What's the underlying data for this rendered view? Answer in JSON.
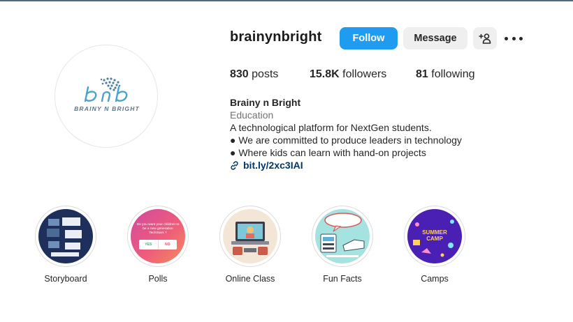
{
  "profile": {
    "username": "brainynbright",
    "avatar_logo_text": "BRAINY N BRIGHT",
    "buttons": {
      "follow": "Follow",
      "message": "Message",
      "add_user_icon": "person-plus-icon",
      "more_icon": "more-horizontal-icon"
    },
    "stats": {
      "posts_count": "830",
      "posts_label": "posts",
      "followers_count": "15.8K",
      "followers_label": "followers",
      "following_count": "81",
      "following_label": "following"
    },
    "bio": {
      "name": "Brainy n Bright",
      "category": "Education",
      "lines": [
        "A technological platform for NextGen students.",
        "● We are committed to produce leaders in technology",
        "● Where kids can learn with hand-on projects"
      ],
      "link": "bit.ly/2xc3IAI"
    }
  },
  "highlights": [
    {
      "label": "Storyboard"
    },
    {
      "label": "Polls",
      "poll_question": "Do you want your children to be a new generation TechStars ?",
      "poll_yes": "YES",
      "poll_no": "NO"
    },
    {
      "label": "Online Class"
    },
    {
      "label": "Fun Facts"
    },
    {
      "label": "Camps",
      "camp_text_1": "SUMMER",
      "camp_text_2": "CAMP"
    }
  ],
  "colors": {
    "follow_button": "#1f9bf0",
    "secondary_button": "#efefef",
    "link": "#00376b",
    "muted_text": "#737373"
  }
}
